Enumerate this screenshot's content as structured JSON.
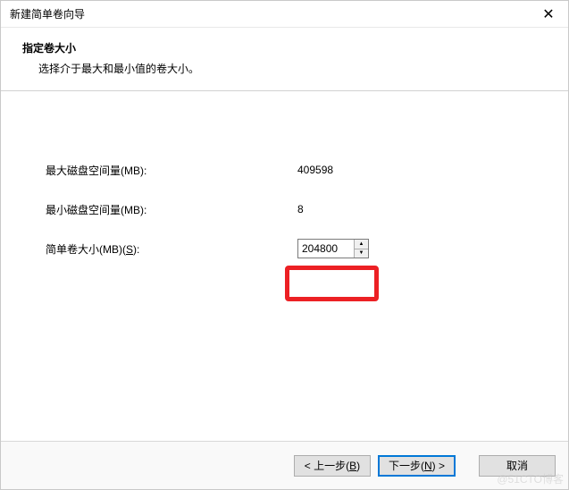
{
  "window": {
    "title": "新建简单卷向导"
  },
  "header": {
    "title": "指定卷大小",
    "subtitle": "选择介于最大和最小值的卷大小。"
  },
  "fields": {
    "max_label": "最大磁盘空间量(MB):",
    "max_value": "409598",
    "min_label": "最小磁盘空间量(MB):",
    "min_value": "8",
    "size_label_pre": "简单卷大小(MB)(",
    "size_hotkey": "S",
    "size_label_post": "):",
    "size_value": "204800"
  },
  "footer": {
    "back_pre": "< 上一步(",
    "back_hot": "B",
    "back_post": ")",
    "next_pre": "下一步(",
    "next_hot": "N",
    "next_post": ") >",
    "cancel": "取消"
  },
  "watermark": "@51CTO博客"
}
